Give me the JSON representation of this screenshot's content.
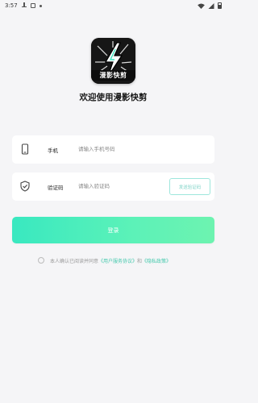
{
  "status_bar": {
    "time": "3:57"
  },
  "logo": {
    "text": "漫影快剪"
  },
  "welcome": "欢迎使用漫影快剪",
  "phone_field": {
    "label": "手机",
    "placeholder": "请输入手机号码"
  },
  "code_field": {
    "label": "验证码",
    "placeholder": "请输入验证码",
    "send_button": "发送验证码"
  },
  "login_button": "登录",
  "agreement": {
    "prefix": "本人确认已阅读并同意",
    "user_agreement": "《用户服务协议》",
    "and": "和",
    "privacy_policy": "《隐私政策》"
  },
  "colors": {
    "accent": "#3de6bf",
    "background": "#f5f5f7"
  }
}
